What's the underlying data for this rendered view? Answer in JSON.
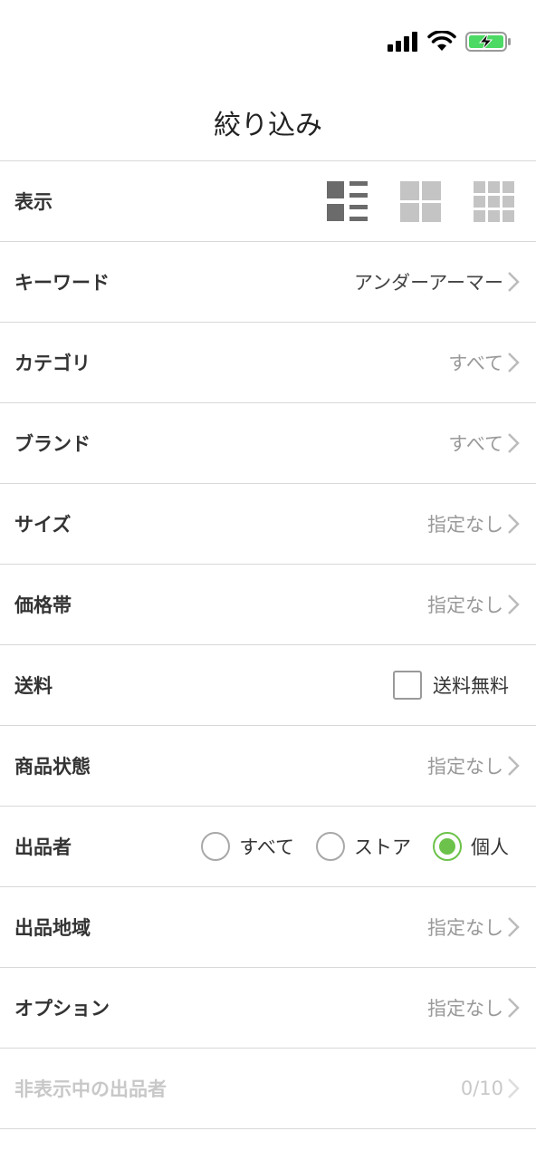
{
  "colors": {
    "accent": "#6cc24a",
    "battery": "#4cd964",
    "divider": "#d8d8d8"
  },
  "header": {
    "title": "絞り込み"
  },
  "rows": {
    "display": {
      "label": "表示",
      "icons": [
        "list-view-icon",
        "grid-2-view-icon",
        "grid-3-view-icon"
      ]
    },
    "keyword": {
      "label": "キーワード",
      "value": "アンダーアーマー"
    },
    "category": {
      "label": "カテゴリ",
      "value": "すべて"
    },
    "brand": {
      "label": "ブランド",
      "value": "すべて"
    },
    "size": {
      "label": "サイズ",
      "value": "指定なし"
    },
    "price": {
      "label": "価格帯",
      "value": "指定なし"
    },
    "shipping": {
      "label": "送料",
      "checkbox_label": "送料無料",
      "checked": false
    },
    "condition": {
      "label": "商品状態",
      "value": "指定なし"
    },
    "seller": {
      "label": "出品者",
      "options": [
        "すべて",
        "ストア",
        "個人"
      ],
      "selected": "個人"
    },
    "region": {
      "label": "出品地域",
      "value": "指定なし"
    },
    "option": {
      "label": "オプション",
      "value": "指定なし"
    },
    "hidden_sellers": {
      "label": "非表示中の出品者",
      "value": "0/10"
    }
  }
}
